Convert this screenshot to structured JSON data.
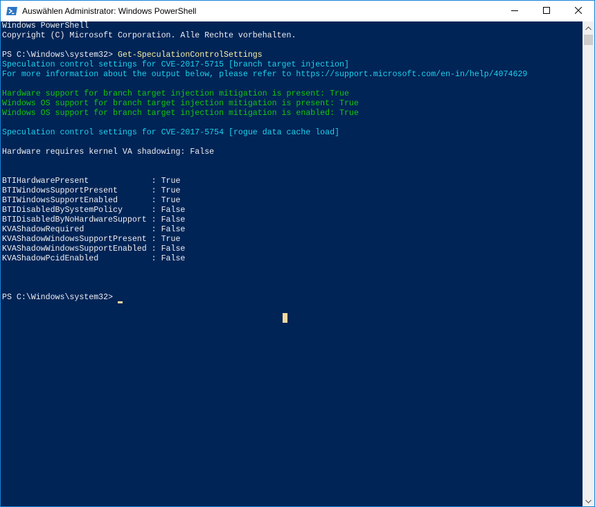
{
  "window": {
    "title": "Auswählen Administrator: Windows PowerShell",
    "icon": "powershell-icon",
    "controls": [
      "minimize-icon",
      "maximize-icon",
      "close-icon"
    ]
  },
  "console": {
    "lines": [
      {
        "text": "Windows PowerShell",
        "color": "white"
      },
      {
        "text": "Copyright (C) Microsoft Corporation. Alle Rechte vorbehalten.",
        "color": "white"
      },
      {
        "text": "",
        "color": "white"
      },
      {
        "prompt": "PS C:\\Windows\\system32> ",
        "command": "Get-SpeculationControlSettings"
      },
      {
        "text": "Speculation control settings for CVE-2017-5715 [branch target injection]",
        "color": "cyan"
      },
      {
        "text": "For more information about the output below, please refer to https://support.microsoft.com/en-in/help/4074629",
        "color": "cyan"
      },
      {
        "text": "",
        "color": "white"
      },
      {
        "text": "Hardware support for branch target injection mitigation is present: True",
        "color": "green"
      },
      {
        "text": "Windows OS support for branch target injection mitigation is present: True",
        "color": "green"
      },
      {
        "text": "Windows OS support for branch target injection mitigation is enabled: True",
        "color": "green"
      },
      {
        "text": "",
        "color": "white"
      },
      {
        "text": "Speculation control settings for CVE-2017-5754 [rogue data cache load]",
        "color": "cyan"
      },
      {
        "text": "",
        "color": "white"
      },
      {
        "text": "Hardware requires kernel VA shadowing: False",
        "color": "white"
      },
      {
        "text": "",
        "color": "white"
      },
      {
        "text": "",
        "color": "white"
      },
      {
        "text": "BTIHardwarePresent             : True",
        "color": "white"
      },
      {
        "text": "BTIWindowsSupportPresent       : True",
        "color": "white"
      },
      {
        "text": "BTIWindowsSupportEnabled       : True",
        "color": "white"
      },
      {
        "text": "BTIDisabledBySystemPolicy      : False",
        "color": "white"
      },
      {
        "text": "BTIDisabledByNoHardwareSupport : False",
        "color": "white"
      },
      {
        "text": "KVAShadowRequired              : False",
        "color": "white"
      },
      {
        "text": "KVAShadowWindowsSupportPresent : True",
        "color": "white"
      },
      {
        "text": "KVAShadowWindowsSupportEnabled : False",
        "color": "white"
      },
      {
        "text": "KVAShadowPcidEnabled           : False",
        "color": "white"
      },
      {
        "text": "",
        "color": "white"
      },
      {
        "text": "",
        "color": "white"
      },
      {
        "text": "",
        "color": "white"
      },
      {
        "prompt": "PS C:\\Windows\\system32> ",
        "command": ""
      }
    ]
  },
  "colors": {
    "background": "#012456",
    "white": "#eeedf0",
    "cyan": "#1fd1ed",
    "green": "#16c60c",
    "command": "#f9f1a5",
    "cursor": "#f9d9a0",
    "window_border": "#1883d7"
  },
  "scrollbar": {
    "up_icon": "scroll-up-arrow-icon",
    "down_icon": "scroll-down-arrow-icon"
  }
}
